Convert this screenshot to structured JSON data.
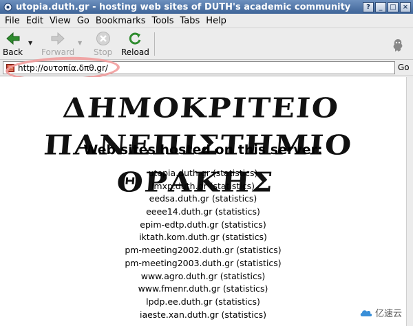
{
  "window": {
    "title": "utopia.duth.gr - hosting web sites of DUTH's academic community",
    "buttons": [
      "?",
      "_",
      "□",
      "×"
    ]
  },
  "menubar": {
    "items": [
      "File",
      "Edit",
      "View",
      "Go",
      "Bookmarks",
      "Tools",
      "Tabs",
      "Help"
    ]
  },
  "toolbar": {
    "back_label": "Back",
    "forward_label": "Forward",
    "stop_label": "Stop",
    "reload_label": "Reload"
  },
  "location": {
    "url": "http://ουτοπία.δπθ.gr/",
    "go_label": "Go"
  },
  "page": {
    "banner_text": "ΔΗΜΟΚΡΙΤΕΙΟ ΠΑΝΕΠΙΣΤΗΜΙΟ ΘΡΑΚΗΣ",
    "heading": "Web sites hosted on this server:",
    "sites": [
      "utopia.duth.gr (statistics)",
      "imxp.duth.gr (statistics)",
      "eedsa.duth.gr (statistics)",
      "eeee14.duth.gr (statistics)",
      "epim-edtp.duth.gr (statistics)",
      "iktath.kom.duth.gr (statistics)",
      "pm-meeting2002.duth.gr (statistics)",
      "pm-meeting2003.duth.gr (statistics)",
      "www.agro.duth.gr (statistics)",
      "www.fmenr.duth.gr (statistics)",
      "lpdp.ee.duth.gr (statistics)",
      "iaeste.xan.duth.gr (statistics)"
    ]
  },
  "watermark": {
    "text": "亿速云"
  },
  "colors": {
    "titlebar": "#4a70a4",
    "highlight_ring": "#f29d9d",
    "back_arrow": "#2e8b2e",
    "reload": "#2e8b2e"
  }
}
